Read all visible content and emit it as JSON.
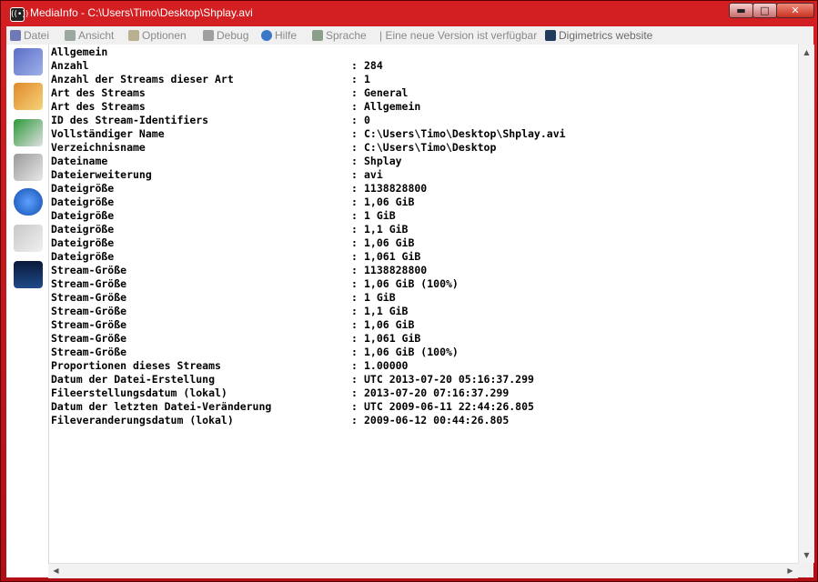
{
  "window": {
    "title": "MediaInfo - C:\\Users\\Timo\\Desktop\\Shplay.avi",
    "app_icon": "((•))",
    "controls": {
      "minimize": "▬",
      "maximize": "□",
      "close": "✕"
    }
  },
  "toolbar": {
    "datei": "Datei",
    "ansicht": "Ansicht",
    "optionen": "Optionen",
    "debug": "Debug",
    "hilfe": "Hilfe",
    "sprache": "Sprache",
    "update_notice": "| Eine neue Version ist verfügbar",
    "website": "Digimetrics website"
  },
  "sidebar": {
    "icons": [
      "basic-info-icon",
      "sheet-view-icon",
      "export-icon",
      "tools-icon",
      "info-icon",
      "multi-file-icon",
      "waveform-icon"
    ]
  },
  "info": {
    "section": "Allgemein",
    "rows": [
      {
        "label": "Anzahl",
        "value": "284"
      },
      {
        "label": "Anzahl der Streams dieser Art",
        "value": "1"
      },
      {
        "label": "Art des Streams",
        "value": "General"
      },
      {
        "label": "Art des Streams",
        "value": "Allgemein"
      },
      {
        "label": "ID des Stream-Identifiers",
        "value": "0"
      },
      {
        "label": "Vollständiger Name",
        "value": "C:\\Users\\Timo\\Desktop\\Shplay.avi"
      },
      {
        "label": "Verzeichnisname",
        "value": "C:\\Users\\Timo\\Desktop"
      },
      {
        "label": "Dateiname",
        "value": "Shplay"
      },
      {
        "label": "Dateierweiterung",
        "value": "avi"
      },
      {
        "label": "Dateigröße",
        "value": "1138828800"
      },
      {
        "label": "Dateigröße",
        "value": "1,06 GiB"
      },
      {
        "label": "Dateigröße",
        "value": "1 GiB"
      },
      {
        "label": "Dateigröße",
        "value": "1,1 GiB"
      },
      {
        "label": "Dateigröße",
        "value": "1,06 GiB"
      },
      {
        "label": "Dateigröße",
        "value": "1,061 GiB"
      },
      {
        "label": "Stream-Größe",
        "value": "1138828800"
      },
      {
        "label": "Stream-Größe",
        "value": "1,06 GiB (100%)"
      },
      {
        "label": "Stream-Größe",
        "value": "1 GiB"
      },
      {
        "label": "Stream-Größe",
        "value": "1,1 GiB"
      },
      {
        "label": "Stream-Größe",
        "value": "1,06 GiB"
      },
      {
        "label": "Stream-Größe",
        "value": "1,061 GiB"
      },
      {
        "label": "Stream-Größe",
        "value": "1,06 GiB (100%)"
      },
      {
        "label": "Proportionen dieses Streams",
        "value": "1.00000"
      },
      {
        "label": "Datum der Datei-Erstellung",
        "value": "UTC 2013-07-20 05:16:37.299"
      },
      {
        "label": "Fileerstellungsdatum (lokal)",
        "value": "2013-07-20 07:16:37.299"
      },
      {
        "label": "Datum der letzten Datei-Veränderung",
        "value": "UTC 2009-06-11 22:44:26.805"
      },
      {
        "label": "Fileveranderungsdatum (lokal)",
        "value": "2009-06-12 00:44:26.805"
      }
    ],
    "separator": ":"
  },
  "scroll": {
    "up": "▲",
    "down": "▼",
    "left": "◀",
    "right": "▶"
  }
}
